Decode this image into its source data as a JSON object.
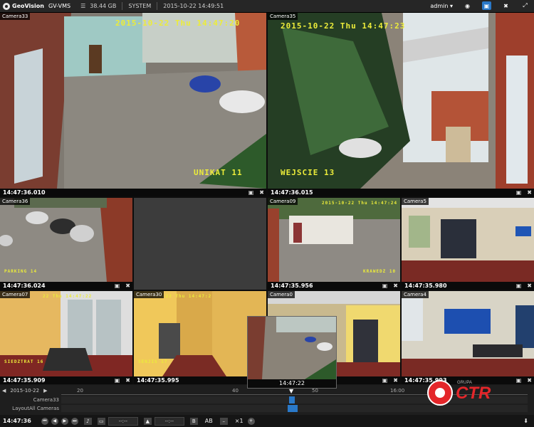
{
  "app": {
    "brand": "GeoVision",
    "name": "GV-VMS"
  },
  "topbar": {
    "disk": "38.44 GB",
    "system": "SYSTEM",
    "datetime": "2015-10-22 14:49:51",
    "user": "admin"
  },
  "cameras": [
    {
      "label": "Camera33",
      "timestamp": "14:47:36.010",
      "osd_top": "2015-10-22 Thu 14:47:20",
      "osd_bottom": "UNIKAT 11"
    },
    {
      "label": "Camera35",
      "timestamp": "14:47:36.015",
      "osd_top": "2015-10-22 Thu 14:47:23",
      "osd_bottom": "WEJSCIE 13"
    },
    {
      "label": "Camera36",
      "timestamp": "14:47:36.024",
      "osd_bottom": "PARKING 14"
    },
    {
      "label": "Camera09",
      "timestamp": "14:47:35.956",
      "osd_top": "2015-10-22 Thu 14:47:24",
      "osd_bottom": "KRAWEDZ 10"
    },
    {
      "label": "Camera5",
      "timestamp": "14:47:35.980"
    },
    {
      "label": "Camera07",
      "timestamp": "14:47:35.909",
      "osd_top": "22 Thu 14:47:22",
      "osd_bottom": "SIEDZTRAT 16"
    },
    {
      "label": "Camera30",
      "timestamp": "14:47:35.995",
      "osd_top": "-22 Thu 14:47:2",
      "osd_bottom": "SENJIS 17"
    },
    {
      "label": "Camera0",
      "timestamp": "14:47:22"
    },
    {
      "label": "Camera4",
      "timestamp": "14:47:35.993"
    }
  ],
  "timeline": {
    "date": "2015-10-22",
    "ticks": [
      "20",
      "40",
      "50",
      "16:00"
    ],
    "tracks": [
      "Camera33",
      "LayoutAll Cameras"
    ]
  },
  "controls": {
    "time": "14:47:36",
    "start_field": "--:--",
    "end_field": "--:--",
    "speed": "×1",
    "aspect": "AB"
  },
  "watermark": {
    "text": "CTR",
    "small": "GRUPA"
  },
  "colors": {
    "osd": "#ecec3a",
    "accent": "#2a79c9",
    "ctr_red": "#e4262a"
  }
}
